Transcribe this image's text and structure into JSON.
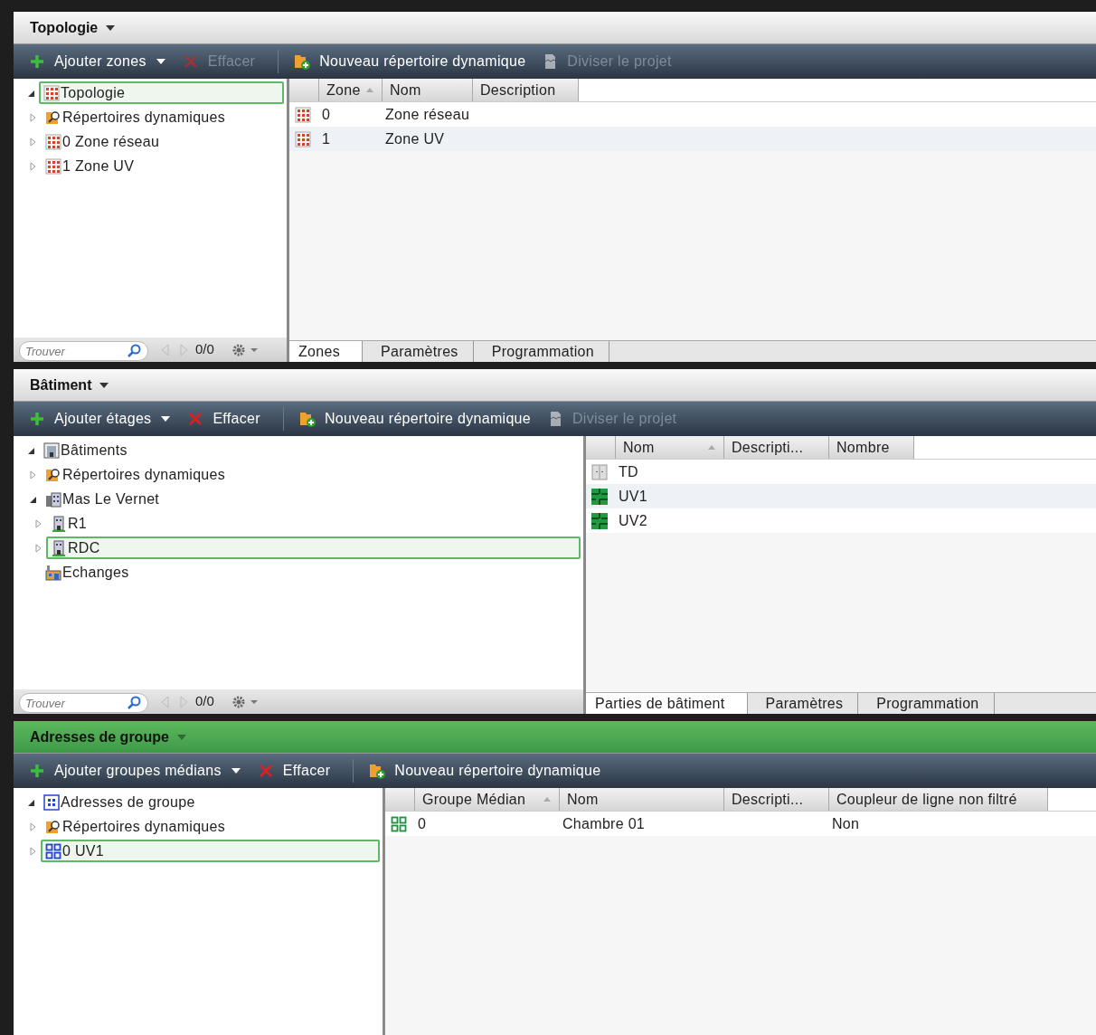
{
  "panels": [
    {
      "title": "Topologie",
      "active": false,
      "toolbar": [
        {
          "kind": "add",
          "label": "Ajouter zones",
          "disabled": false,
          "dropdown": true
        },
        {
          "kind": "delete",
          "label": "Effacer",
          "disabled": true,
          "dropdown": false
        },
        {
          "kind": "new-folder",
          "label": "Nouveau répertoire dynamique",
          "disabled": false,
          "dropdown": false
        },
        {
          "kind": "split",
          "label": "Diviser le projet",
          "disabled": true,
          "dropdown": false
        }
      ],
      "tree": [
        {
          "label": "Topologie",
          "kind": "topology",
          "expanded": true,
          "selected": true,
          "children": [
            {
              "label": "Répertoires dynamiques",
              "kind": "dynamic-folder",
              "expanded": false,
              "selected": false
            },
            {
              "label": "0 Zone réseau",
              "kind": "zone",
              "expanded": false,
              "selected": false
            },
            {
              "label": "1 Zone UV",
              "kind": "zone",
              "expanded": false,
              "selected": false
            }
          ]
        }
      ],
      "search": {
        "placeholder": "Trouver",
        "counter": "0/0"
      },
      "columns": [
        {
          "label": "Zone",
          "sorted": true
        },
        {
          "label": "Nom",
          "sorted": false
        },
        {
          "label": "Description",
          "sorted": false
        }
      ],
      "rows": [
        {
          "kind": "zone",
          "cells": [
            "0",
            "Zone réseau"
          ]
        },
        {
          "kind": "zone",
          "cells": [
            "1",
            "Zone UV"
          ]
        }
      ],
      "tabs": [
        {
          "label": "Zones",
          "selected": true
        },
        {
          "label": "Paramètres",
          "selected": false
        },
        {
          "label": "Programmation",
          "selected": false
        }
      ]
    },
    {
      "title": "Bâtiment",
      "active": false,
      "toolbar": [
        {
          "kind": "add",
          "label": "Ajouter étages",
          "disabled": false,
          "dropdown": true
        },
        {
          "kind": "delete",
          "label": "Effacer",
          "disabled": false,
          "dropdown": false
        },
        {
          "kind": "new-folder",
          "label": "Nouveau répertoire dynamique",
          "disabled": false,
          "dropdown": false
        },
        {
          "kind": "split",
          "label": "Diviser le projet",
          "disabled": true,
          "dropdown": false
        }
      ],
      "tree": [
        {
          "label": "Bâtiments",
          "kind": "buildings",
          "expanded": true,
          "selected": false,
          "children": [
            {
              "label": "Répertoires dynamiques",
              "kind": "dynamic-folder",
              "expanded": false,
              "selected": false
            },
            {
              "label": "Mas Le Vernet",
              "kind": "building",
              "expanded": true,
              "selected": false,
              "children": [
                {
                  "label": "R1",
                  "kind": "floor",
                  "expanded": false,
                  "selected": false
                },
                {
                  "label": "RDC",
                  "kind": "floor",
                  "expanded": false,
                  "selected": true
                }
              ]
            },
            {
              "label": "Echanges",
              "kind": "factory",
              "selected": false
            }
          ]
        }
      ],
      "search": {
        "placeholder": "Trouver",
        "counter": "0/0"
      },
      "columns": [
        {
          "label": "Nom",
          "sorted": true
        },
        {
          "label": "Descripti...",
          "sorted": false
        },
        {
          "label": "Nombre",
          "sorted": false
        }
      ],
      "rows": [
        {
          "kind": "cabinet",
          "cells": [
            "TD"
          ]
        },
        {
          "kind": "room",
          "cells": [
            "UV1"
          ]
        },
        {
          "kind": "room",
          "cells": [
            "UV2"
          ]
        }
      ],
      "tabs": [
        {
          "label": "Parties de bâtiment",
          "selected": true
        },
        {
          "label": "Paramètres",
          "selected": false
        },
        {
          "label": "Programmation",
          "selected": false
        }
      ]
    },
    {
      "title": "Adresses de groupe",
      "active": true,
      "toolbar": [
        {
          "kind": "add",
          "label": "Ajouter groupes médians",
          "disabled": false,
          "dropdown": true
        },
        {
          "kind": "delete",
          "label": "Effacer",
          "disabled": false,
          "dropdown": false
        },
        {
          "kind": "new-folder",
          "label": "Nouveau répertoire dynamique",
          "disabled": false,
          "dropdown": false
        }
      ],
      "tree": [
        {
          "label": "Adresses de groupe",
          "kind": "group-addresses",
          "expanded": true,
          "selected": false,
          "children": [
            {
              "label": "Répertoires dynamiques",
              "kind": "dynamic-folder",
              "expanded": false,
              "selected": false
            },
            {
              "label": "0 UV1",
              "kind": "middle-group",
              "expanded": false,
              "selected": true
            }
          ]
        }
      ],
      "columns": [
        {
          "label": "Groupe Médian",
          "sorted": true
        },
        {
          "label": "Nom",
          "sorted": false
        },
        {
          "label": "Descripti...",
          "sorted": false
        },
        {
          "label": "Coupleur de ligne non filtré",
          "sorted": false
        }
      ],
      "rows": [
        {
          "kind": "middle-group-green",
          "cells": [
            "0",
            "Chambre 01",
            "",
            "Non"
          ]
        }
      ]
    }
  ]
}
